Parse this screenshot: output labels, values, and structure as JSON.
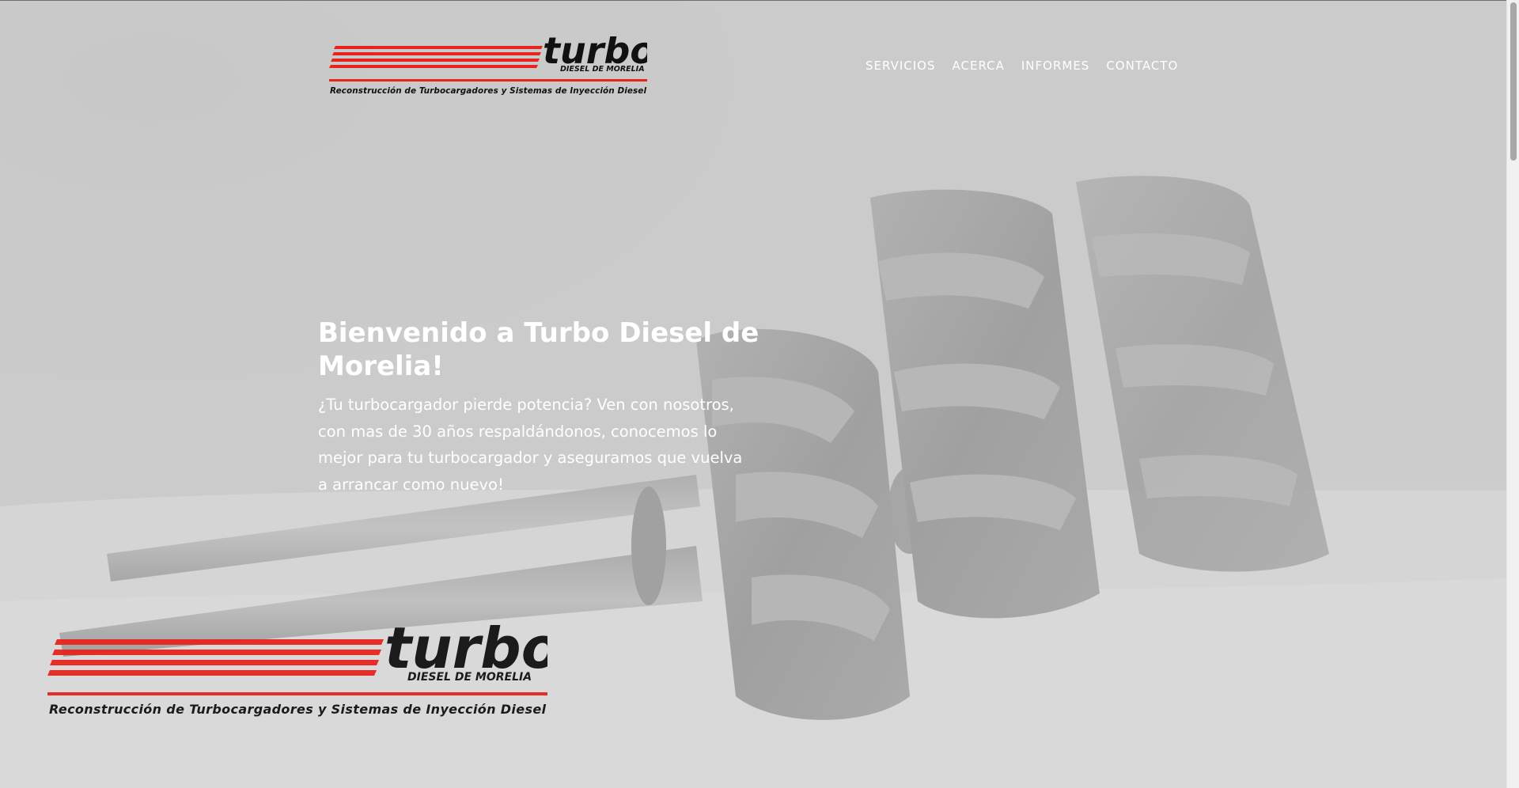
{
  "brand": {
    "word": "turbo",
    "sub": "DIESEL DE MORELIA",
    "tagline": "Reconstrucción de Turbocargadores y Sistemas de Inyección Diesel",
    "accent": "#e8241f"
  },
  "nav": {
    "items": [
      {
        "label": "SERVICIOS"
      },
      {
        "label": "ACERCA"
      },
      {
        "label": "INFORMES"
      },
      {
        "label": "CONTACTO"
      }
    ]
  },
  "hero": {
    "title": "Bienvenido a Turbo Diesel de Morelia!",
    "subtitle": "¿Tu turbocargador pierde potencia? Ven con nosotros, con mas de 30 años respaldándonos, conocemos lo mejor para tu turbocargador y aseguramos que vuelva a arrancar como nuevo!"
  },
  "colors": {
    "background": "#c9c9c9",
    "text": "#ffffff"
  }
}
